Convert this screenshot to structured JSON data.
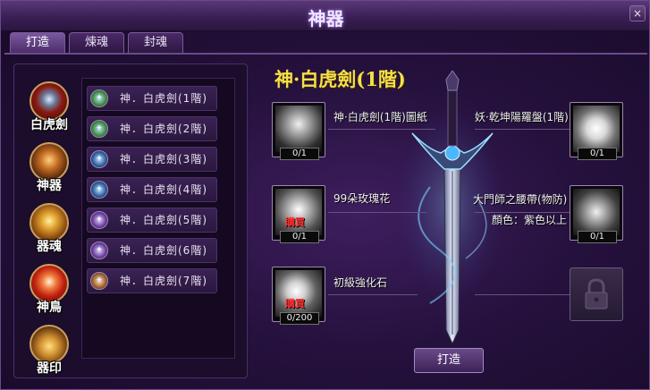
{
  "window": {
    "title": "神器",
    "close_label": "×"
  },
  "tabs": [
    {
      "label": "打造",
      "active": true
    },
    {
      "label": "煉魂",
      "active": false
    },
    {
      "label": "封魂",
      "active": false
    }
  ],
  "categories": [
    {
      "label": "白虎劍",
      "selected": true,
      "color": "#c03020"
    },
    {
      "label": "神器",
      "selected": false,
      "color": "#b06a20"
    },
    {
      "label": "器魂",
      "selected": false,
      "color": "#c08a20"
    },
    {
      "label": "神鳥",
      "selected": false,
      "color": "#d04020"
    },
    {
      "label": "器印",
      "selected": false,
      "color": "#c07a20"
    }
  ],
  "items": [
    {
      "label": "神．白虎劍(1階)",
      "icon_color": "#3a8a3a"
    },
    {
      "label": "神．白虎劍(2階)",
      "icon_color": "#3a8a3a"
    },
    {
      "label": "神．白虎劍(3階)",
      "icon_color": "#2a5a9a"
    },
    {
      "label": "神．白虎劍(4階)",
      "icon_color": "#2a5a9a"
    },
    {
      "label": "神．白虎劍(5階)",
      "icon_color": "#6a3a9a"
    },
    {
      "label": "神．白虎劍(6階)",
      "icon_color": "#6a3a9a"
    },
    {
      "label": "神．白虎劍(7階)",
      "icon_color": "#9a5a2a"
    }
  ],
  "selected_item": {
    "name": "神·白虎劍(1階)"
  },
  "materials_left": [
    {
      "name": "神·白虎劍(1階)圖紙",
      "count": "0/1",
      "buy": "",
      "icon": "sword-blueprint-icon"
    },
    {
      "name": "99朵玫瑰花",
      "count": "0/1",
      "buy": "購買",
      "icon": "rose-heart-icon"
    },
    {
      "name": "初級強化石",
      "count": "0/200",
      "buy": "購買",
      "icon": "crystal-icon"
    }
  ],
  "materials_right": [
    {
      "name": "妖·乾坤陽羅盤(1階)",
      "count": "0/1",
      "icon": "compass-scroll-icon"
    },
    {
      "name": "大門師之腰帶(物防)",
      "subtext": "顏色：紫色以上",
      "count": "0/1",
      "icon": "belt-icon"
    }
  ],
  "craft_button": {
    "label": "打造"
  },
  "accent_colors": {
    "item_name": "#f4e04a",
    "buy_text": "#ff3030",
    "frame": "#6a4a8a"
  }
}
